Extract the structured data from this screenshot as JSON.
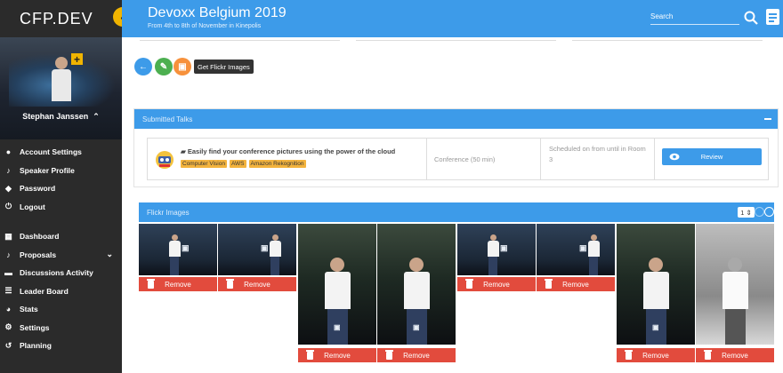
{
  "brand": "CFP.DEV",
  "event": {
    "title": "Devoxx Belgium 2019",
    "subtitle": "From 4th to 8th of November in Kinepolis"
  },
  "search": {
    "placeholder": "Search"
  },
  "user": {
    "name": "Stephan Janssen"
  },
  "sidebar": {
    "account_items": [
      {
        "label": "Account Settings",
        "icon": "person-icon"
      },
      {
        "label": "Speaker Profile",
        "icon": "microphone-icon"
      },
      {
        "label": "Password",
        "icon": "shield-icon"
      },
      {
        "label": "Logout",
        "icon": "power-icon"
      }
    ],
    "main_items": [
      {
        "label": "Dashboard",
        "icon": "dashboard-icon"
      },
      {
        "label": "Proposals",
        "icon": "microphone-icon"
      },
      {
        "label": "Discussions Activity",
        "icon": "chat-icon"
      },
      {
        "label": "Leader Board",
        "icon": "list-icon"
      },
      {
        "label": "Stats",
        "icon": "pie-chart-icon"
      },
      {
        "label": "Settings",
        "icon": "gear-icon"
      },
      {
        "label": "Planning",
        "icon": "history-icon"
      }
    ]
  },
  "actions": {
    "tooltip": "Get Flickr Images"
  },
  "submitted": {
    "header": "Submitted Talks",
    "talk": {
      "title": "Easily find your conference pictures using the power of the cloud",
      "tags": [
        "Computer Vision",
        "AWS",
        "Amazon Rekognition"
      ],
      "format": "Conference (50 min)",
      "schedule": "Scheduled on from until in Room 3",
      "review_label": "Review"
    }
  },
  "flickr": {
    "header": "Flickr Images",
    "page": "1",
    "remove_label": "Remove",
    "photo_count": 8
  },
  "colors": {
    "accent": "#3d9be9",
    "sidebar": "#2b2b2b",
    "remove": "#e24b3d",
    "tag": "#f3b33d",
    "edit": "#4caf50",
    "flickr": "#f7913b"
  }
}
